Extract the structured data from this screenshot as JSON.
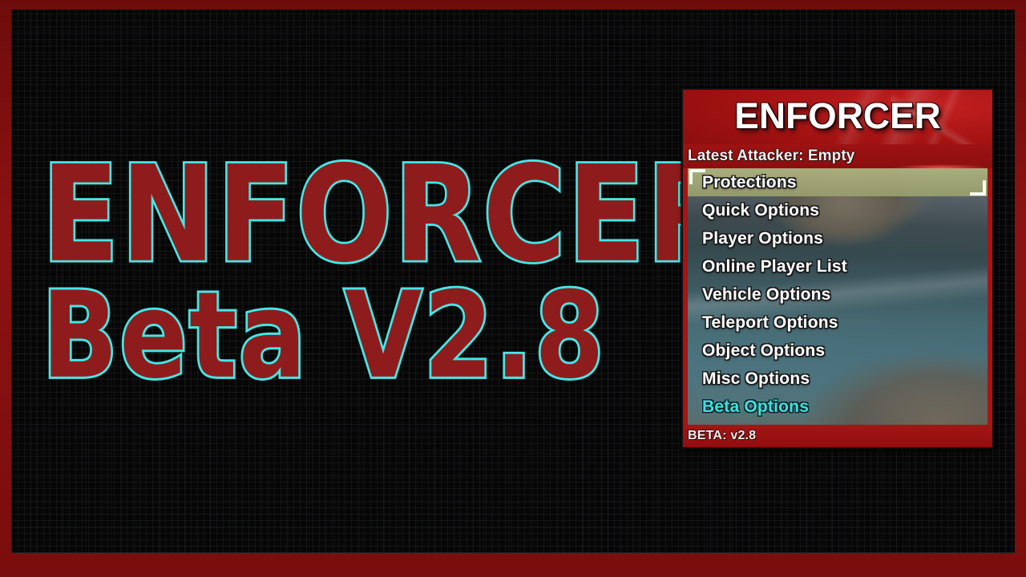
{
  "thumbnail": {
    "title_line_1": "ENFORCER",
    "title_line_2": "Beta V2.8",
    "title_fill_color": "#8f1c1c",
    "title_outline_color": "#45e6e6",
    "frame_color": "#7a0d0d",
    "background_color": "#060606"
  },
  "menu": {
    "wordmark": "ENFORCER",
    "attacker_label": "Latest Attacker: Empty",
    "version_label": "BETA: v2.8",
    "accent_color": "#a81414",
    "selected_row_color": "#9aa06e",
    "highlight_text_color": "#3fe0e0",
    "options": [
      {
        "label": "Protections",
        "selected": true,
        "highlight": false
      },
      {
        "label": "Quick Options",
        "selected": false,
        "highlight": false
      },
      {
        "label": "Player Options",
        "selected": false,
        "highlight": false
      },
      {
        "label": "Online Player List",
        "selected": false,
        "highlight": false
      },
      {
        "label": "Vehicle Options",
        "selected": false,
        "highlight": false
      },
      {
        "label": "Teleport Options",
        "selected": false,
        "highlight": false
      },
      {
        "label": "Object Options",
        "selected": false,
        "highlight": false
      },
      {
        "label": "Misc Options",
        "selected": false,
        "highlight": false
      },
      {
        "label": "Beta Options",
        "selected": false,
        "highlight": true
      }
    ]
  }
}
